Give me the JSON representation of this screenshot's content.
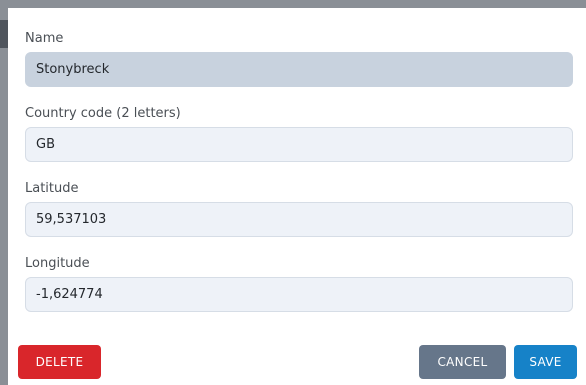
{
  "form": {
    "name": {
      "label": "Name",
      "value": "Stonybreck"
    },
    "country_code": {
      "label": "Country code (2 letters)",
      "value": "GB"
    },
    "latitude": {
      "label": "Latitude",
      "value": "59,537103"
    },
    "longitude": {
      "label": "Longitude",
      "value": "-1,624774"
    }
  },
  "actions": {
    "delete_label": "DELETE",
    "cancel_label": "CANCEL",
    "save_label": "SAVE"
  },
  "colors": {
    "delete": "#d9262b",
    "cancel": "#66768a",
    "save": "#1682c8",
    "focused_field": "#c8d2de",
    "field": "#eef2f8"
  }
}
